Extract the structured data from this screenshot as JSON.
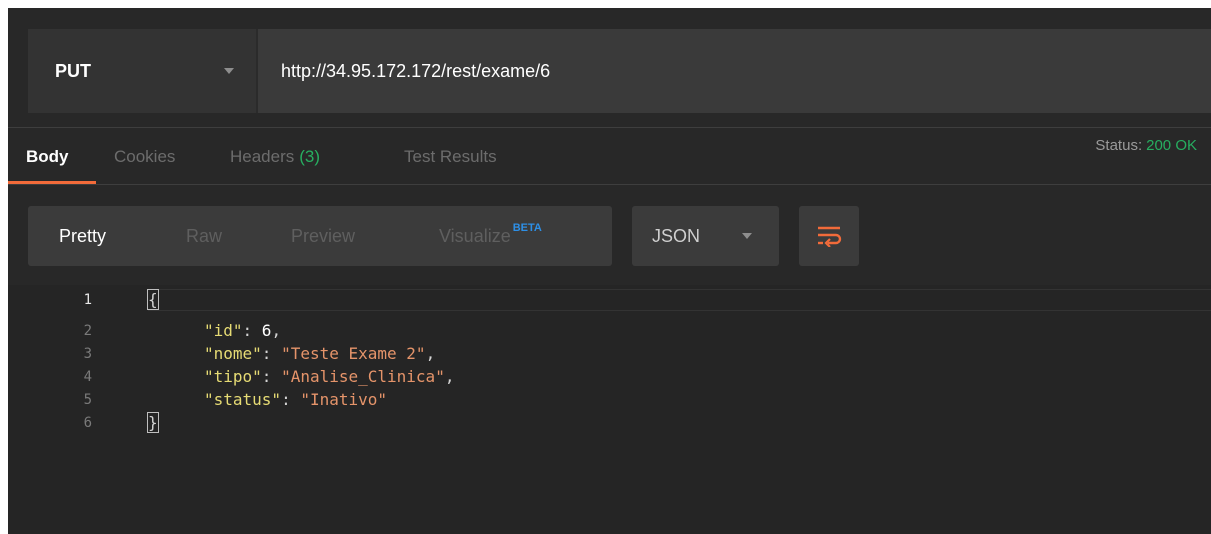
{
  "request": {
    "method": "PUT",
    "url": "http://34.95.172.172/rest/exame/6"
  },
  "response_tabs": {
    "body": "Body",
    "cookies": "Cookies",
    "headers": "Headers",
    "headers_count": "(3)",
    "test_results": "Test Results"
  },
  "status": {
    "label": "Status:",
    "value": "200 OK"
  },
  "format": {
    "pretty": "Pretty",
    "raw": "Raw",
    "preview": "Preview",
    "visualize": "Visualize",
    "beta_badge": "BETA",
    "language": "JSON"
  },
  "editor": {
    "line_numbers": [
      "1",
      "2",
      "3",
      "4",
      "5",
      "6"
    ],
    "open_brace": "{",
    "close_brace": "}",
    "fields": [
      {
        "key": "\"id\"",
        "value": "6",
        "value_type": "number",
        "comma": ","
      },
      {
        "key": "\"nome\"",
        "value": "\"Teste Exame 2\"",
        "value_type": "string",
        "comma": ","
      },
      {
        "key": "\"tipo\"",
        "value": "\"Analise_Clinica\"",
        "value_type": "string",
        "comma": ","
      },
      {
        "key": "\"status\"",
        "value": "\"Inativo\"",
        "value_type": "string",
        "comma": ""
      }
    ]
  },
  "colors": {
    "accent": "#f26b3a",
    "status_ok": "#27ae60",
    "beta": "#2d8fe6",
    "json_key": "#e6db74",
    "json_string": "#e5946a"
  },
  "icons": {
    "method_caret": "chevron-down-icon",
    "language_caret": "chevron-down-icon",
    "wrap": "wrap-lines-icon"
  }
}
